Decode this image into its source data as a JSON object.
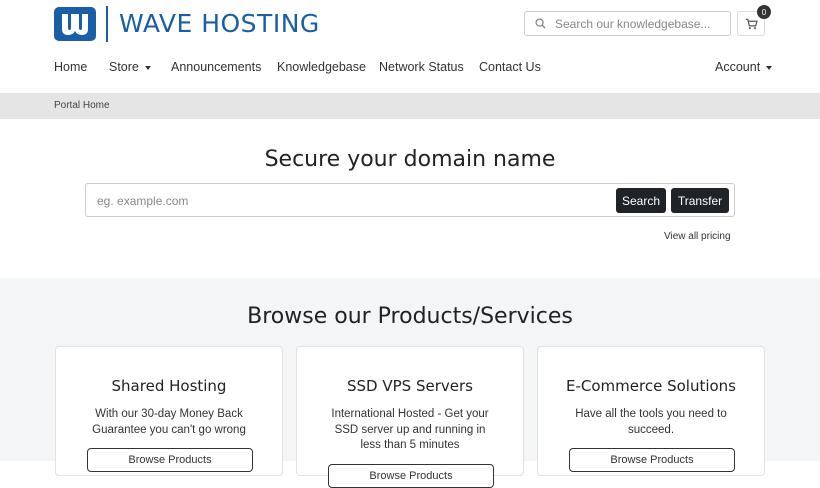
{
  "brand": {
    "name": "WAVE HOSTING",
    "color": "#1a5ea8"
  },
  "header": {
    "search_placeholder": "Search our knowledgebase...",
    "cart_count": "0"
  },
  "nav": {
    "items": [
      {
        "label": "Home"
      },
      {
        "label": "Store",
        "dropdown": true
      },
      {
        "label": "Announcements"
      },
      {
        "label": "Knowledgebase"
      },
      {
        "label": "Network Status"
      },
      {
        "label": "Contact Us"
      }
    ],
    "account": {
      "label": "Account",
      "dropdown": true
    }
  },
  "breadcrumb": {
    "label": "Portal Home"
  },
  "domain": {
    "title": "Secure your domain name",
    "placeholder": "eg. example.com",
    "search_label": "Search",
    "transfer_label": "Transfer",
    "pricing_link": "View all pricing"
  },
  "products": {
    "title": "Browse our Products/Services",
    "cards": [
      {
        "title": "Shared Hosting",
        "description": "With our 30-day Money Back Guarantee you can't go wrong",
        "button": "Browse Products"
      },
      {
        "title": "SSD VPS Servers",
        "description": "International Hosted - Get your SSD server up and running in less than 5 minutes",
        "button": "Browse Products"
      },
      {
        "title": "E-Commerce Solutions",
        "description": "Have all the tools you need to succeed.",
        "button": "Browse Products"
      }
    ]
  }
}
